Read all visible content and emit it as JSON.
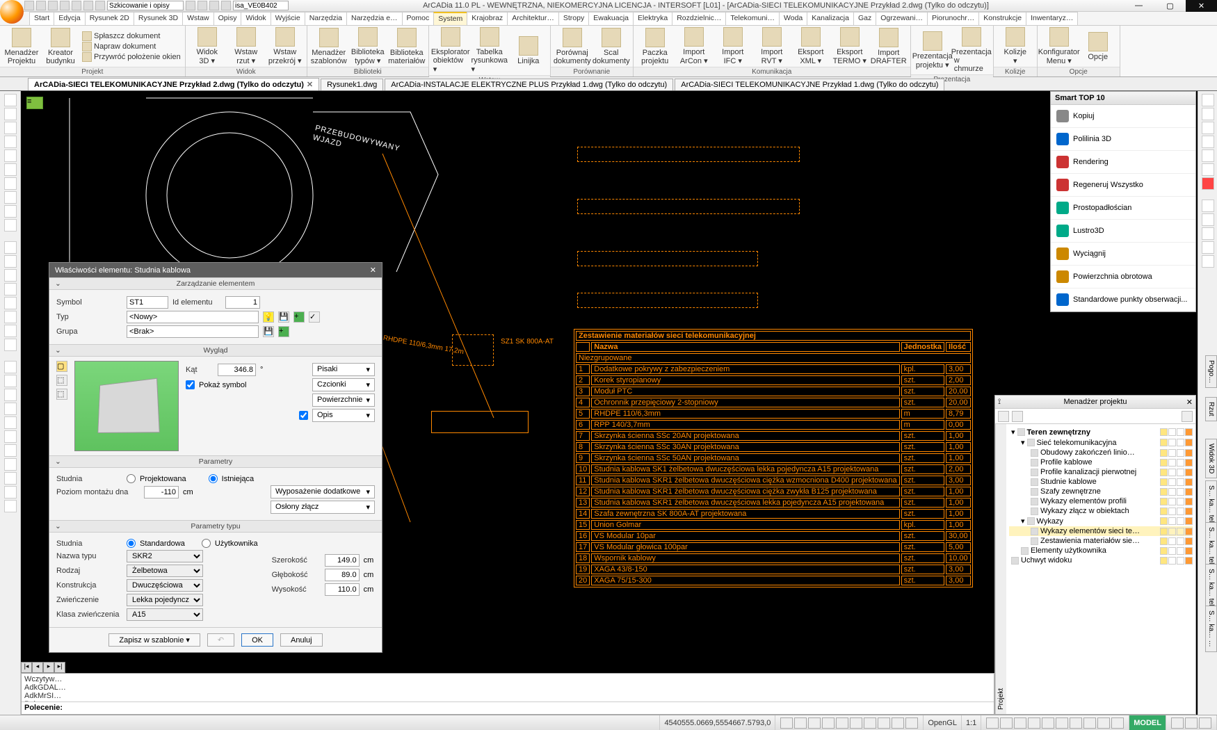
{
  "window": {
    "title": "ArCADia 11.0 PL - WEWNĘTRZNA, NIEKOMERCYJNA LICENCJA - INTERSOFT [L01] - [ArCADia-SIECI TELEKOMUNIKACYJNE Przykład 2.dwg (Tylko do odczytu)]",
    "qat_combo1": "Szkicowanie i opisy",
    "qat_combo2": "isa_VE0B402"
  },
  "menus": [
    "Start",
    "Edycja",
    "Rysunek 2D",
    "Rysunek 3D",
    "Wstaw",
    "Opisy",
    "Widok",
    "Wyjście",
    "Narzędzia",
    "Narzędzia e…",
    "Pomoc",
    "System",
    "Krajobraz",
    "Architektur…",
    "Stropy",
    "Ewakuacja",
    "Elektryka",
    "Rozdzielnic…",
    "Telekomuni…",
    "Woda",
    "Kanalizacja",
    "Gaz",
    "Ogrzewani…",
    "Piorunochr…",
    "Konstrukcje",
    "Inwentaryz…"
  ],
  "menu_active": "System",
  "ribbon": {
    "groups": [
      {
        "label": "Projekt",
        "big": [
          {
            "l1": "Menadżer",
            "l2": "Projektu"
          },
          {
            "l1": "Kreator",
            "l2": "budynku"
          }
        ],
        "rows": [
          "Spłaszcz dokument",
          "Napraw dokument",
          "Przywróć położenie okien"
        ]
      },
      {
        "label": "Widok",
        "big": [
          {
            "l1": "Widok",
            "l2": "3D ▾"
          },
          {
            "l1": "Wstaw",
            "l2": "rzut ▾"
          },
          {
            "l1": "Wstaw",
            "l2": "przekrój ▾"
          }
        ]
      },
      {
        "label": "Biblioteki",
        "big": [
          {
            "l1": "Menadżer",
            "l2": "szablonów"
          },
          {
            "l1": "Biblioteka",
            "l2": "typów ▾"
          },
          {
            "l1": "Biblioteka",
            "l2": "materiałów"
          }
        ]
      },
      {
        "label": "Wstaw",
        "big": [
          {
            "l1": "Eksplorator",
            "l2": "obiektów ▾"
          },
          {
            "l1": "Tabelka",
            "l2": "rysunkowa ▾"
          },
          {
            "l1": "Linijka",
            "l2": ""
          }
        ]
      },
      {
        "label": "Porównanie",
        "big": [
          {
            "l1": "Porównaj",
            "l2": "dokumenty"
          },
          {
            "l1": "Scal",
            "l2": "dokumenty"
          }
        ]
      },
      {
        "label": "Komunikacja",
        "big": [
          {
            "l1": "Paczka",
            "l2": "projektu"
          },
          {
            "l1": "Import",
            "l2": "ArCon ▾"
          },
          {
            "l1": "Import",
            "l2": "IFC ▾"
          },
          {
            "l1": "Import",
            "l2": "RVT ▾"
          },
          {
            "l1": "Eksport",
            "l2": "XML ▾"
          },
          {
            "l1": "Eksport",
            "l2": "TERMO ▾"
          },
          {
            "l1": "Import",
            "l2": "DRAFTER"
          }
        ]
      },
      {
        "label": "Prezentacja",
        "big": [
          {
            "l1": "Prezentacja",
            "l2": "projektu ▾"
          },
          {
            "l1": "Prezentacja",
            "l2": "w chmurze"
          }
        ]
      },
      {
        "label": "Kolizje",
        "big": [
          {
            "l1": "Kolizje",
            "l2": "▾"
          }
        ]
      },
      {
        "label": "Opcje",
        "big": [
          {
            "l1": "Konfigurator",
            "l2": "Menu ▾"
          },
          {
            "l1": "Opcje",
            "l2": ""
          }
        ]
      }
    ]
  },
  "tabs": [
    {
      "label": "ArCADia-SIECI TELEKOMUNIKACYJNE Przykład 2.dwg (Tylko do odczytu)",
      "active": true,
      "close": true
    },
    {
      "label": "Rysunek1.dwg",
      "active": false,
      "close": false
    },
    {
      "label": "ArCADia-INSTALACJE ELEKTRYCZNE PLUS Przykład 1.dwg (Tylko do odczytu)",
      "active": false,
      "close": false
    },
    {
      "label": "ArCADia-SIECI TELEKOMUNIKACYJNE Przykład 1.dwg (Tylko do odczytu)",
      "active": false,
      "close": false
    }
  ],
  "smart": {
    "title": "Smart TOP 10",
    "items": [
      "Kopiuj",
      "Polilinia 3D",
      "Rendering",
      "Regeneruj Wszystko",
      "Prostopadłościan",
      "Lustro3D",
      "Wyciągnij",
      "Powierzchnia obrotowa",
      "Standardowe punkty obserwacji..."
    ]
  },
  "proj": {
    "title": "Menadżer projektu",
    "side_tab": "Projekt",
    "tree": [
      {
        "lvl": 0,
        "exp": "▾",
        "label": "Teren zewnętrzny",
        "bold": true
      },
      {
        "lvl": 1,
        "exp": "▾",
        "label": "Sieć telekomunikacyjna"
      },
      {
        "lvl": 2,
        "label": "Obudowy zakończeń linio…"
      },
      {
        "lvl": 2,
        "label": "Profile kablowe"
      },
      {
        "lvl": 2,
        "label": "Profile kanalizacji pierwotnej"
      },
      {
        "lvl": 2,
        "label": "Studnie kablowe"
      },
      {
        "lvl": 2,
        "label": "Szafy zewnętrzne"
      },
      {
        "lvl": 2,
        "label": "Wykazy elementów profili"
      },
      {
        "lvl": 2,
        "label": "Wykazy złącz w obiektach"
      },
      {
        "lvl": 1,
        "exp": "▾",
        "label": "Wykazy"
      },
      {
        "lvl": 2,
        "label": "Wykazy elementów sieci te…",
        "sel": true
      },
      {
        "lvl": 2,
        "label": "Zestawienia materiałów sie…"
      },
      {
        "lvl": 1,
        "label": "Elementy użytkownika"
      },
      {
        "lvl": 0,
        "label": "Uchwyt widoku"
      }
    ]
  },
  "dialog": {
    "title": "Właściwości elementu: Studnia kablowa",
    "sec1": "Zarządzanie elementem",
    "symbol_l": "Symbol",
    "symbol_v": "ST1",
    "id_l": "Id elementu",
    "id_v": "1",
    "typ_l": "Typ",
    "typ_v": "<Nowy>",
    "grupa_l": "Grupa",
    "grupa_v": "<Brak>",
    "sec2": "Wygląd",
    "kat_l": "Kąt",
    "kat_v": "346.8",
    "kat_u": "°",
    "pokaz": "Pokaż symbol",
    "pisaki": "Pisaki",
    "czcionki": "Czcionki",
    "powierzchnie": "Powierzchnie",
    "opis": "Opis",
    "sec3": "Parametry",
    "studnia_l": "Studnia",
    "proj": "Projektowana",
    "ist": "Istniejąca",
    "poziom_l": "Poziom montażu dna",
    "poziom_v": "-110",
    "cm": "cm",
    "wyposazenie": "Wyposażenie dodatkowe",
    "oslony": "Osłony złącz",
    "sec4": "Parametry typu",
    "stdnia2_l": "Studnia",
    "std": "Standardowa",
    "uzyt": "Użytkownika",
    "nazwa_l": "Nazwa typu",
    "nazwa_v": "SKR2",
    "rodzaj_l": "Rodzaj",
    "rodzaj_v": "Żelbetowa",
    "konst_l": "Konstrukcja",
    "konst_v": "Dwuczęściowa",
    "zwien_l": "Zwieńczenie",
    "zwien_v": "Lekka pojedyncza",
    "klasa_l": "Klasa zwieńczenia",
    "klasa_v": "A15",
    "szer_l": "Szerokość",
    "szer_v": "149.0",
    "gleb_l": "Głębokość",
    "gleb_v": "89.0",
    "wys_l": "Wysokość",
    "wys_v": "110.0",
    "zapisz": "Zapisz w szablonie",
    "ok": "OK",
    "anuluj": "Anuluj"
  },
  "vp": {
    "label1": "PRZEBUDOWYWANY",
    "label2": "WJAZD",
    "label3": "WANY",
    "pipe": "RHDPE 110/6,3mm 17,2m",
    "box_label": "SZ1 SK 800A-AT",
    "table_title": "Zestawienie materiałów sieci telekomunikacyjnej",
    "cols": [
      "",
      "Nazwa",
      "Jednostka",
      "Ilość"
    ],
    "group_row": "Niezgrupowane",
    "rows": [
      [
        "1",
        "Dodatkowe pokrywy z zabezpieczeniem",
        "kpl.",
        "3,00"
      ],
      [
        "2",
        "Korek styropianowy",
        "szt.",
        "2,00"
      ],
      [
        "3",
        "Moduł PTC",
        "szt.",
        "20,00"
      ],
      [
        "4",
        "Ochronnik przepięciowy 2-stopniowy",
        "szt.",
        "20,00"
      ],
      [
        "5",
        "RHDPE 110/6,3mm",
        "m",
        "8,79"
      ],
      [
        "6",
        "RPP 140/3,7mm",
        "m",
        "0,00"
      ],
      [
        "7",
        "Skrzynka ścienna SSc 20AN projektowana",
        "szt.",
        "1,00"
      ],
      [
        "8",
        "Skrzynka ścienna SSc 30AN projektowana",
        "szt.",
        "1,00"
      ],
      [
        "9",
        "Skrzynka ścienna SSc 50AN projektowana",
        "szt.",
        "1,00"
      ],
      [
        "10",
        "Studnia kablowa SK1 żelbetowa dwuczęściowa lekka pojedyncza A15 projektowana",
        "szt.",
        "2,00"
      ],
      [
        "11",
        "Studnia kablowa SKR1 żelbetowa dwuczęściowa ciężka wzmocniona D400 projektowana",
        "szt.",
        "3,00"
      ],
      [
        "12",
        "Studnia kablowa SKR1 żelbetowa dwuczęściowa ciężka zwykła B125 projektowana",
        "szt.",
        "1,00"
      ],
      [
        "13",
        "Studnia kablowa SKR1 żelbetowa dwuczęściowa lekka pojedyncza A15 projektowana",
        "szt.",
        "1,00"
      ],
      [
        "14",
        "Szafa zewnętrzna SK 800A-AT projektowana",
        "szt.",
        "1,00"
      ],
      [
        "15",
        "Union Golmar",
        "kpl.",
        "1,00"
      ],
      [
        "16",
        "VS Modular 10par",
        "szt.",
        "30,00"
      ],
      [
        "17",
        "VS Modular głowica 100par",
        "szt.",
        "5,00"
      ],
      [
        "18",
        "Wspornik kablowy",
        "szt.",
        "10,00"
      ],
      [
        "19",
        "XAGA 43/8-150",
        "szt.",
        "3,00"
      ],
      [
        "20",
        "XAGA 75/15-300",
        "szt.",
        "3,00"
      ]
    ]
  },
  "cmd": {
    "hist": [
      "Wczytyw…",
      "AdkGDAL…",
      "AdkMrSI…",
      "Polecen…"
    ],
    "prompt": "Polecenie:"
  },
  "status": {
    "coords": "4540555.0669,5554667.5793,0",
    "ogl": "OpenGL",
    "scale": "1:1",
    "model": "MODEL"
  },
  "right_side_tabs": [
    "Pogo…",
    "Rzut",
    "Widok 3D",
    "S… ka… tel. …",
    "S… ka… tel. …",
    "S… ka… tel. …",
    "S… ka… …"
  ]
}
